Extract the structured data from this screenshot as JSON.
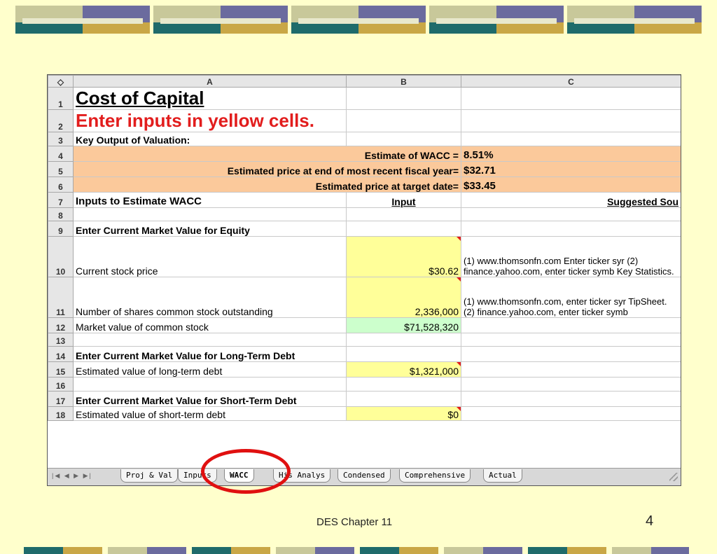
{
  "spreadsheet": {
    "corner_symbol": "◇",
    "columns": [
      "A",
      "B",
      "C"
    ],
    "rows": [
      {
        "n": "1",
        "a": "Cost of Capital",
        "b": "",
        "c": ""
      },
      {
        "n": "2",
        "a": "Enter inputs in yellow cells.",
        "b": "",
        "c": ""
      },
      {
        "n": "3",
        "a": "Key Output of Valuation:",
        "b": "",
        "c": ""
      },
      {
        "n": "4",
        "a": "Estimate of WACC =",
        "b": "8.51%",
        "c": ""
      },
      {
        "n": "5",
        "a": "Estimated price at end of most recent fiscal year=",
        "b": "$32.71",
        "c": ""
      },
      {
        "n": "6",
        "a": "Estimated price at target date=",
        "b": "$33.45",
        "c": ""
      },
      {
        "n": "7",
        "a": "Inputs to Estimate WACC",
        "b": "Input",
        "c": "Suggested Sou"
      },
      {
        "n": "8",
        "a": "",
        "b": "",
        "c": ""
      },
      {
        "n": "9",
        "a": "Enter Current Market Value for Equity",
        "b": "",
        "c": ""
      },
      {
        "n": "10",
        "a": "Current stock price",
        "b": "$30.62",
        "c": "(1) www.thomsonfn.com Enter ticker syr (2) finance.yahoo.com, enter ticker symb Key Statistics."
      },
      {
        "n": "11",
        "a": "Number of shares common stock outstanding",
        "b": "2,336,000",
        "c": "(1) www.thomsonfn.com, enter ticker syr TipSheet. (2) finance.yahoo.com, enter ticker symb"
      },
      {
        "n": "12",
        "a": "Market value of common stock",
        "b": "$71,528,320",
        "c": ""
      },
      {
        "n": "13",
        "a": "",
        "b": "",
        "c": ""
      },
      {
        "n": "14",
        "a": "Enter Current Market Value for Long-Term Debt",
        "b": "",
        "c": ""
      },
      {
        "n": "15",
        "a": "Estimated value of long-term debt",
        "b": "$1,321,000",
        "c": ""
      },
      {
        "n": "16",
        "a": "",
        "b": "",
        "c": ""
      },
      {
        "n": "17",
        "a": "Enter Current Market Value for Short-Term Debt",
        "b": "",
        "c": ""
      },
      {
        "n": "18",
        "a": "Estimated value of short-term debt",
        "b": "$0",
        "c": ""
      }
    ],
    "sheet_tabs": [
      "Proj & Val",
      "Inputs",
      "WACC",
      "His Analys",
      "Condensed",
      "Comprehensive",
      "Actual"
    ],
    "active_tab": "WACC"
  },
  "footer": {
    "text": "DES Chapter 11",
    "page": "4"
  },
  "colors": {
    "peach": "#fbc99b",
    "yellow_input": "#ffff99",
    "green_output": "#ccffcc",
    "title_red": "#e21d1d",
    "label_blue": "#1b1bb0",
    "highlight_circle": "#e01010"
  },
  "icons": [
    "tab-nav-arrows-icon",
    "resize-grip-icon"
  ]
}
